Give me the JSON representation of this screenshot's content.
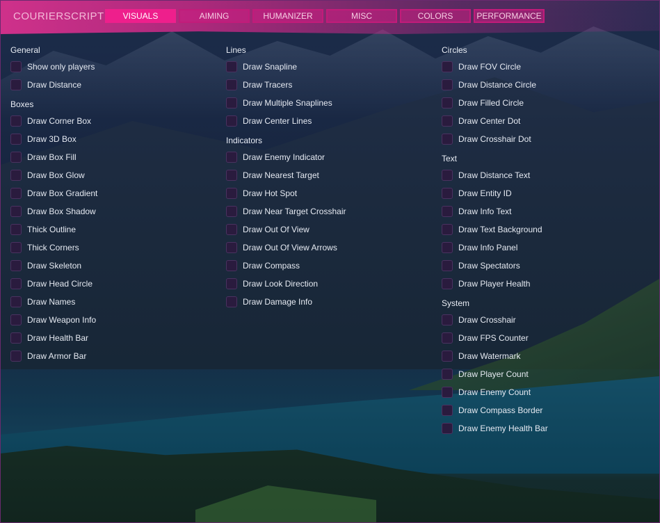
{
  "app": {
    "title": "COURIERSCRIPT",
    "accent_color": "#ee1f8c"
  },
  "tabs": [
    {
      "label": "VISUALS",
      "active": true
    },
    {
      "label": "AIMING",
      "active": false
    },
    {
      "label": "HUMANIZER",
      "active": false
    },
    {
      "label": "MISC",
      "active": false
    },
    {
      "label": "COLORS",
      "active": false
    },
    {
      "label": "PERFORMANCE",
      "active": false
    }
  ],
  "columns": [
    {
      "sections": [
        {
          "title": "General",
          "items": [
            "Show only players",
            "Draw Distance"
          ]
        },
        {
          "title": "Boxes",
          "items": [
            "Draw Corner Box",
            "Draw 3D Box",
            "Draw Box Fill",
            "Draw Box Glow",
            "Draw Box Gradient",
            "Draw Box Shadow",
            "Thick Outline",
            "Thick Corners",
            "Draw Skeleton",
            "Draw Head Circle",
            "Draw Names",
            "Draw Weapon Info",
            "Draw Health Bar",
            "Draw Armor Bar"
          ]
        }
      ]
    },
    {
      "sections": [
        {
          "title": "Lines",
          "items": [
            "Draw Snapline",
            "Draw Tracers",
            "Draw Multiple Snaplines",
            "Draw Center Lines"
          ]
        },
        {
          "title": "Indicators",
          "items": [
            "Draw Enemy Indicator",
            "Draw Nearest Target",
            "Draw Hot Spot",
            "Draw Near Target Crosshair",
            "Draw Out Of View",
            "Draw Out Of View Arrows",
            "Draw Compass",
            "Draw Look Direction",
            "Draw Damage Info"
          ]
        }
      ]
    },
    {
      "sections": [
        {
          "title": "Circles",
          "items": [
            "Draw FOV Circle",
            "Draw Distance Circle",
            "Draw Filled Circle",
            "Draw Center Dot",
            "Draw Crosshair Dot"
          ]
        },
        {
          "title": "Text",
          "items": [
            "Draw Distance Text",
            "Draw Entity ID",
            "Draw Info Text",
            "Draw Text Background",
            "Draw Info Panel",
            "Draw Spectators",
            "Draw Player Health"
          ]
        },
        {
          "title": "System",
          "items": [
            "Draw Crosshair",
            "Draw FPS Counter",
            "Draw Watermark",
            "Draw Player Count",
            "Draw Enemy Count",
            "Draw Compass Border",
            "Draw Enemy Health Bar"
          ]
        }
      ]
    }
  ]
}
